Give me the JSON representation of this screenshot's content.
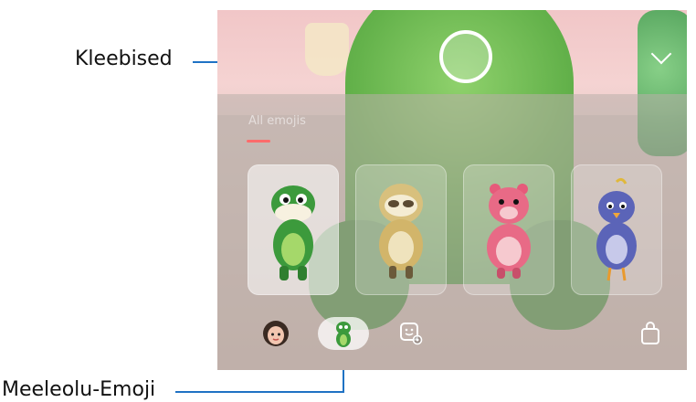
{
  "callouts": {
    "stickers": "Kleebised",
    "mood_emoji": "Meeleolu-Emoji"
  },
  "panel": {
    "tab_label": "All emojis"
  },
  "cards": [
    {
      "name": "dinosaur",
      "selected": true
    },
    {
      "name": "sloth",
      "selected": false
    },
    {
      "name": "pink-bear",
      "selected": false
    },
    {
      "name": "blue-bird",
      "selected": false
    }
  ],
  "toolbar": {
    "items": [
      "my-emoji",
      "emoji-stickers",
      "sticker-settings",
      "shopping-bag"
    ],
    "selected": "emoji-stickers"
  },
  "colors": {
    "callout_line": "#1f72c4",
    "tab_underline": "#ff6b6b"
  }
}
